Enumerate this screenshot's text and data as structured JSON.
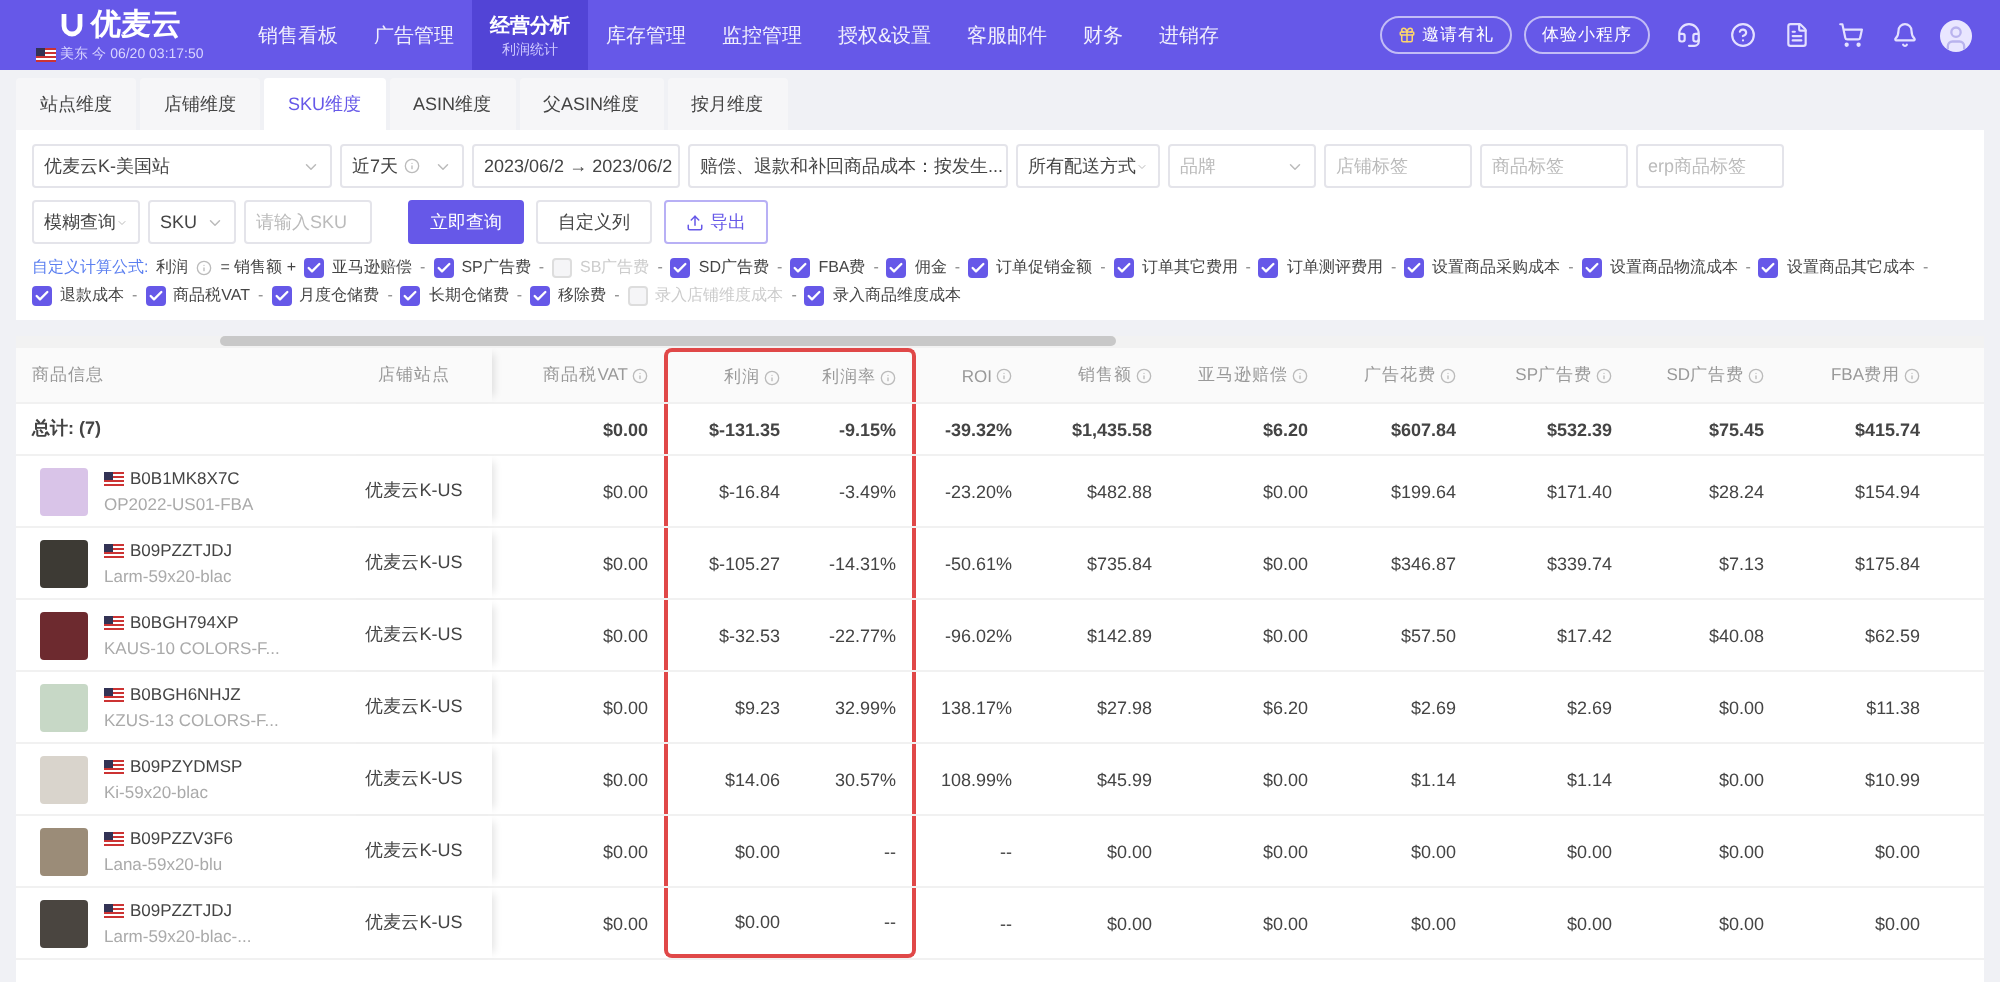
{
  "header": {
    "brand": "优麦云",
    "clock": "美东 今 06/20 03:17:50",
    "nav": [
      {
        "label": "销售看板",
        "selected": false
      },
      {
        "label": "广告管理",
        "selected": false
      },
      {
        "label": "经营分析",
        "selected": true,
        "sub": "利润统计"
      },
      {
        "label": "库存管理",
        "selected": false
      },
      {
        "label": "监控管理",
        "selected": false
      },
      {
        "label": "授权&设置",
        "selected": false
      },
      {
        "label": "客服邮件",
        "selected": false
      },
      {
        "label": "财务",
        "selected": false
      },
      {
        "label": "进销存",
        "selected": false
      }
    ],
    "buttons": [
      {
        "label": "邀请有礼",
        "kind": "gift"
      },
      {
        "label": "体验小程序",
        "kind": "plain"
      }
    ]
  },
  "tabs": [
    {
      "label": "站点维度",
      "selected": false
    },
    {
      "label": "店铺维度",
      "selected": false
    },
    {
      "label": "SKU维度",
      "selected": true
    },
    {
      "label": "ASIN维度",
      "selected": false
    },
    {
      "label": "父ASIN维度",
      "selected": false
    },
    {
      "label": "按月维度",
      "selected": false
    }
  ],
  "filters": {
    "row1": [
      {
        "kind": "select",
        "value": "优麦云K-美国站"
      },
      {
        "kind": "select",
        "value": "近7天",
        "info": true
      },
      {
        "kind": "range",
        "from": "2023/06/2",
        "arrow": "→",
        "to": "2023/06/2"
      },
      {
        "kind": "select",
        "value": "赔偿、退款和补回商品成本：按发生..."
      },
      {
        "kind": "select",
        "value": "所有配送方式"
      },
      {
        "kind": "select",
        "placeholder": "品牌"
      },
      {
        "kind": "input",
        "placeholder": "店铺标签"
      },
      {
        "kind": "input",
        "placeholder": "商品标签"
      },
      {
        "kind": "input",
        "placeholder": "erp商品标签"
      }
    ],
    "search_mode": "模糊查询",
    "search_field": "SKU",
    "search_placeholder": "请输入SKU",
    "actions": [
      {
        "label": "立即查询",
        "kind": "primary"
      },
      {
        "label": "自定义列",
        "kind": "plain"
      },
      {
        "label": "导出",
        "kind": "export"
      }
    ]
  },
  "formula": {
    "title": "自定义计算公式:",
    "target": "利润",
    "lead": "= 销售额 +",
    "items": [
      {
        "label": "亚马逊赔偿",
        "checked": true,
        "disabled": false,
        "op": "-"
      },
      {
        "label": "SP广告费",
        "checked": true,
        "disabled": false,
        "op": "-"
      },
      {
        "label": "SB广告费",
        "checked": false,
        "disabled": true,
        "op": "-"
      },
      {
        "label": "SD广告费",
        "checked": true,
        "disabled": false,
        "op": "-"
      },
      {
        "label": "FBA费",
        "checked": true,
        "disabled": false,
        "op": "-"
      },
      {
        "label": "佣金",
        "checked": true,
        "disabled": false,
        "op": "-"
      },
      {
        "label": "订单促销金额",
        "checked": true,
        "disabled": false,
        "op": "-"
      },
      {
        "label": "订单其它费用",
        "checked": true,
        "disabled": false,
        "op": "-"
      },
      {
        "label": "订单测评费用",
        "checked": true,
        "disabled": false,
        "op": "-"
      },
      {
        "label": "设置商品采购成本",
        "checked": true,
        "disabled": false,
        "op": "-"
      },
      {
        "label": "设置商品物流成本",
        "checked": true,
        "disabled": false,
        "op": "-"
      },
      {
        "label": "设置商品其它成本",
        "checked": true,
        "disabled": false,
        "op": "-"
      },
      {
        "label": "退款成本",
        "checked": true,
        "disabled": false,
        "op": "-"
      },
      {
        "label": "商品税VAT",
        "checked": true,
        "disabled": false,
        "op": "-"
      },
      {
        "label": "月度仓储费",
        "checked": true,
        "disabled": false,
        "op": "-"
      },
      {
        "label": "长期仓储费",
        "checked": true,
        "disabled": false,
        "op": "-"
      },
      {
        "label": "移除费",
        "checked": true,
        "disabled": false,
        "op": "-"
      },
      {
        "label": "录入店铺维度成本",
        "checked": false,
        "disabled": true,
        "op": "-"
      },
      {
        "label": "录入商品维度成本",
        "checked": true,
        "disabled": false
      }
    ]
  },
  "table": {
    "columns": [
      {
        "label": "商品信息",
        "info": false,
        "highlighted": false
      },
      {
        "label": "店铺站点",
        "info": false,
        "highlighted": false
      },
      {
        "label": "商品税VAT",
        "info": true,
        "highlighted": false
      },
      {
        "label": "利润",
        "info": true,
        "highlighted": true
      },
      {
        "label": "利润率",
        "info": true,
        "highlighted": true
      },
      {
        "label": "ROI",
        "info": true,
        "highlighted": false
      },
      {
        "label": "销售额",
        "info": true,
        "highlighted": false
      },
      {
        "label": "亚马逊赔偿",
        "info": true,
        "highlighted": false
      },
      {
        "label": "广告花费",
        "info": true,
        "highlighted": false
      },
      {
        "label": "SP广告费",
        "info": true,
        "highlighted": false
      },
      {
        "label": "SD广告费",
        "info": true,
        "highlighted": false
      },
      {
        "label": "FBA费用",
        "info": true,
        "highlighted": false
      }
    ],
    "total": {
      "label": "总计: (7)",
      "values": [
        "$0.00",
        "$-131.35",
        "-9.15%",
        "-39.32%",
        "$1,435.58",
        "$6.20",
        "$607.84",
        "$532.39",
        "$75.45",
        "$415.74"
      ]
    },
    "rows": [
      {
        "asin": "B0B1MK8X7C",
        "sku": "OP2022-US01-FBA",
        "store": "优麦云K-US",
        "values": [
          "$0.00",
          "$-16.84",
          "-3.49%",
          "-23.20%",
          "$482.88",
          "$0.00",
          "$199.64",
          "$171.40",
          "$28.24",
          "$154.94"
        ]
      },
      {
        "asin": "B09PZZTJDJ",
        "sku": "Larm-59x20-blac",
        "store": "优麦云K-US",
        "values": [
          "$0.00",
          "$-105.27",
          "-14.31%",
          "-50.61%",
          "$735.84",
          "$0.00",
          "$346.87",
          "$339.74",
          "$7.13",
          "$175.84"
        ]
      },
      {
        "asin": "B0BGH794XP",
        "sku": "KAUS-10 COLORS-F...",
        "store": "优麦云K-US",
        "values": [
          "$0.00",
          "$-32.53",
          "-22.77%",
          "-96.02%",
          "$142.89",
          "$0.00",
          "$57.50",
          "$17.42",
          "$40.08",
          "$62.59"
        ]
      },
      {
        "asin": "B0BGH6NHJZ",
        "sku": "KZUS-13 COLORS-F...",
        "store": "优麦云K-US",
        "values": [
          "$0.00",
          "$9.23",
          "32.99%",
          "138.17%",
          "$27.98",
          "$6.20",
          "$2.69",
          "$2.69",
          "$0.00",
          "$11.38"
        ]
      },
      {
        "asin": "B09PZYDMSP",
        "sku": "Ki-59x20-blac",
        "store": "优麦云K-US",
        "values": [
          "$0.00",
          "$14.06",
          "30.57%",
          "108.99%",
          "$45.99",
          "$0.00",
          "$1.14",
          "$1.14",
          "$0.00",
          "$10.99"
        ]
      },
      {
        "asin": "B09PZZV3F6",
        "sku": "Lana-59x20-blu",
        "store": "优麦云K-US",
        "values": [
          "$0.00",
          "$0.00",
          "--",
          "--",
          "$0.00",
          "$0.00",
          "$0.00",
          "$0.00",
          "$0.00",
          "$0.00"
        ]
      },
      {
        "asin": "B09PZZTJDJ",
        "sku": "Larm-59x20-blac-...",
        "store": "优麦云K-US",
        "values": [
          "$0.00",
          "$0.00",
          "--",
          "--",
          "$0.00",
          "$0.00",
          "$0.00",
          "$0.00",
          "$0.00",
          "$0.00"
        ]
      }
    ]
  }
}
